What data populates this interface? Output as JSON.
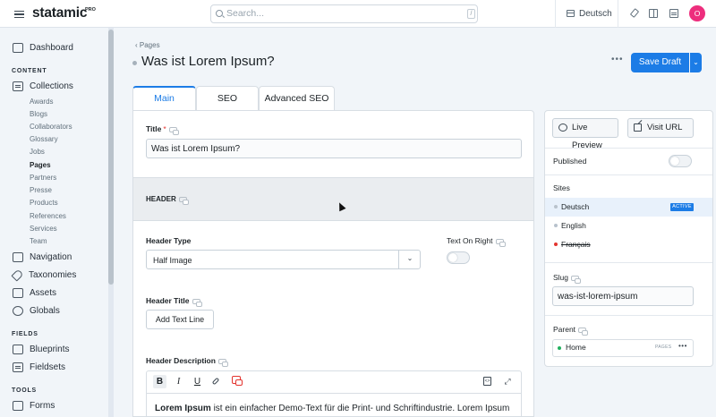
{
  "app": {
    "logo": "statamic",
    "logo_badge": "PRO"
  },
  "topbar": {
    "search_placeholder": "Search...",
    "search_shortcut": "/",
    "site_selector": "Deutsch",
    "avatar_initial": "O",
    "avatar_color": "#ed2e7d"
  },
  "sidebar": {
    "dashboard": "Dashboard",
    "content_heading": "CONTENT",
    "collections": "Collections",
    "collection_items": [
      "Awards",
      "Blogs",
      "Collaborators",
      "Glossary",
      "Jobs",
      "Pages",
      "Partners",
      "Presse",
      "Products",
      "References",
      "Services",
      "Team"
    ],
    "active_collection": "Pages",
    "navigation": "Navigation",
    "taxonomies": "Taxonomies",
    "assets": "Assets",
    "globals": "Globals",
    "fields_heading": "FIELDS",
    "blueprints": "Blueprints",
    "fieldsets": "Fieldsets",
    "tools_heading": "TOOLS",
    "forms": "Forms"
  },
  "page": {
    "breadcrumb": "Pages",
    "title": "Was ist Lorem Ipsum?",
    "more": "•••",
    "save_label": "Save Draft",
    "save_caret": "⌄"
  },
  "tabs": [
    "Main",
    "SEO",
    "Advanced SEO"
  ],
  "active_tab": "Main",
  "main": {
    "title_label": "Title",
    "title_required": "*",
    "title_value": "Was ist Lorem Ipsum?",
    "header_section": "HEADER",
    "header_type_label": "Header Type",
    "header_type_value": "Half Image",
    "text_on_right_label": "Text On Right",
    "header_title_label": "Header Title",
    "add_text_line": "Add Text Line",
    "header_description_label": "Header Description",
    "toolbar": {
      "bold": "B",
      "italic": "I",
      "underline": "U",
      "expand": "⤢"
    },
    "desc_bold": "Lorem Ipsum",
    "desc_rest": " ist ein einfacher Demo-Text für die Print- und Schriftindustrie. Lorem Ipsum"
  },
  "side": {
    "live_preview": "Live Preview",
    "visit_url": "Visit URL",
    "published_label": "Published",
    "sites_label": "Sites",
    "sites": [
      {
        "name": "Deutsch",
        "active": true,
        "badge": "ACTIVE"
      },
      {
        "name": "English",
        "active": false
      },
      {
        "name": "Français",
        "active": false,
        "disabled": true
      }
    ],
    "slug_label": "Slug",
    "slug_value": "was-ist-lorem-ipsum",
    "parent_label": "Parent",
    "parent_value": "Home",
    "parent_tag": "PAGES",
    "parent_more": "•••"
  }
}
